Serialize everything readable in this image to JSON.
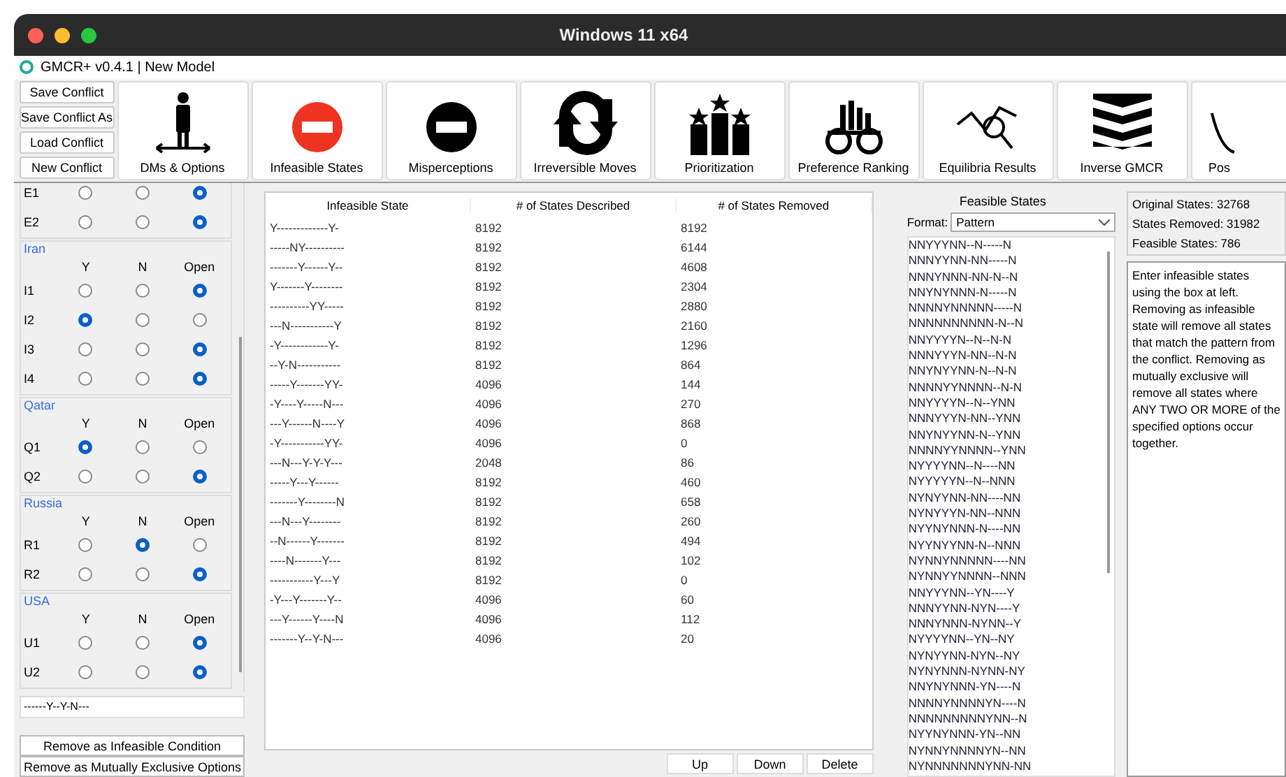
{
  "host_bar": {
    "title": "Windows 11 x64"
  },
  "window": {
    "title": "GMCR+ v0.4.1 | New Model"
  },
  "file_buttons": [
    "Save Conflict",
    "Save Conflict As",
    "Load Conflict",
    "New Conflict"
  ],
  "tools": [
    {
      "label": "DMs & Options"
    },
    {
      "label": "Infeasible States"
    },
    {
      "label": "Misperceptions"
    },
    {
      "label": "Irreversible Moves"
    },
    {
      "label": "Prioritization"
    },
    {
      "label": "Preference Ranking"
    },
    {
      "label": "Equilibria Results"
    },
    {
      "label": "Inverse GMCR"
    },
    {
      "label": "Pos"
    }
  ],
  "groups": [
    {
      "options": [
        {
          "label": "E1",
          "choices": [
            false,
            false,
            true
          ]
        },
        {
          "label": "E2",
          "choices": [
            false,
            false,
            true
          ]
        }
      ]
    },
    {
      "name": "Iran",
      "headers": [
        "Y",
        "N",
        "Open"
      ],
      "options": [
        {
          "label": "I1",
          "choices": [
            false,
            false,
            true
          ]
        },
        {
          "label": "I2",
          "choices": [
            true,
            false,
            false
          ]
        },
        {
          "label": "I3",
          "choices": [
            false,
            false,
            true
          ]
        },
        {
          "label": "I4",
          "choices": [
            false,
            false,
            true
          ]
        }
      ]
    },
    {
      "name": "Qatar",
      "headers": [
        "Y",
        "N",
        "Open"
      ],
      "options": [
        {
          "label": "Q1",
          "choices": [
            true,
            false,
            false
          ]
        },
        {
          "label": "Q2",
          "choices": [
            false,
            false,
            true
          ]
        }
      ]
    },
    {
      "name": "Russia",
      "headers": [
        "Y",
        "N",
        "Open"
      ],
      "options": [
        {
          "label": "R1",
          "choices": [
            false,
            true,
            false
          ]
        },
        {
          "label": "R2",
          "choices": [
            false,
            false,
            true
          ]
        }
      ]
    },
    {
      "name": "USA",
      "headers": [
        "Y",
        "N",
        "Open"
      ],
      "options": [
        {
          "label": "U1",
          "choices": [
            false,
            false,
            true
          ]
        },
        {
          "label": "U2",
          "choices": [
            false,
            false,
            true
          ]
        }
      ]
    }
  ],
  "pattern_field": {
    "value": "------Y--Y-N---"
  },
  "action_buttons": [
    "Remove as Infeasible Condition",
    "Remove as Mutually Exclusive Options"
  ],
  "table": {
    "columns": [
      "Infeasible State",
      "# of States Described",
      "# of States Removed"
    ],
    "rows": [
      [
        "Y-------------Y-",
        "8192",
        "8192"
      ],
      [
        "-----NY----------",
        "8192",
        "6144"
      ],
      [
        "-------Y------Y--",
        "8192",
        "4608"
      ],
      [
        "Y-------Y--------",
        "8192",
        "2304"
      ],
      [
        "----------YY-----",
        "8192",
        "2880"
      ],
      [
        "---N-----------Y",
        "8192",
        "2160"
      ],
      [
        "-Y------------Y-",
        "8192",
        "1296"
      ],
      [
        "--Y-N-----------",
        "8192",
        "864"
      ],
      [
        "-----Y-------YY-",
        "4096",
        "144"
      ],
      [
        "-Y----Y-----N---",
        "4096",
        "270"
      ],
      [
        "---Y------N----Y",
        "4096",
        "868"
      ],
      [
        "-Y-----------YY-",
        "4096",
        "0"
      ],
      [
        "---N---Y-Y-Y---",
        "2048",
        "86"
      ],
      [
        "-----Y---Y------",
        "8192",
        "460"
      ],
      [
        "-------Y--------N",
        "8192",
        "658"
      ],
      [
        "---N---Y--------",
        "8192",
        "260"
      ],
      [
        "--N------Y-------",
        "8192",
        "494"
      ],
      [
        "----N-------Y---",
        "8192",
        "102"
      ],
      [
        "-----------Y---Y",
        "8192",
        "0"
      ],
      [
        "-Y---Y-------Y--",
        "4096",
        "60"
      ],
      [
        "---Y------Y----N",
        "4096",
        "112"
      ],
      [
        "-------Y--Y-N---",
        "4096",
        "20"
      ]
    ]
  },
  "table_buttons": [
    "Up",
    "Down",
    "Delete"
  ],
  "feasible": {
    "title": "Feasible States",
    "format_label": "Format:",
    "format_value": "Pattern",
    "states": [
      "NNYYYNN--N-----N",
      "NNNYYNN-NN-----N",
      "NNNYNNN-NN-N--N",
      "NNYNYNNN-N-----N",
      "NNNNYNNNNN-----N",
      "NNNNNNNNNN-N--N",
      "NNYYYYN--N--N-N",
      "NNNYYYN-NN--N-N",
      "NNYNYYNN-N--N-N",
      "NNNNYYNNNN--N-N",
      "NNYYYYN--N--YNN",
      "NNNYYYN-NN--YNN",
      "NNYNYYNN-N--YNN",
      "NNNNYYNNNN--YNN",
      "NYYYYNN--N----NN",
      "NYYYYYN--N--NNN",
      "NYNYYNN-NN----NN",
      "NYNYYYN-NN--NNN",
      "NYYNYNNN-N----NN",
      "NYYNYYNN-N--NNN",
      "NYNNYNNNNN----NN",
      "NYNNYYNNNN--NNN",
      "NNYYYNN--YN----Y",
      "NNNYYNN-NYN----Y",
      "NNNYNNN-NYNN--Y",
      "NYYYYNN--YN--NY",
      "NYNYYNN-NYN--NY",
      "NYNYNNN-NYNN-NY",
      "NNYNYNNN-YN----N",
      "NNNNYNNNNYN----N",
      "NNNNNNNNNYNN--N",
      "NYYNYNNN-YN--NN",
      "NYNNYNNNNYN--NN",
      "NYNNNNNNNYNN-NN"
    ]
  },
  "summary": [
    "Original States: 32768",
    "States Removed: 31982",
    "Feasible States: 786"
  ],
  "help_text": "Enter infeasible states using the box at left. Removing as infeasible state will remove all states that match the pattern from the conflict. Removing as mutually exclusive will remove all states where ANY TWO OR MORE of the specified options occur together."
}
